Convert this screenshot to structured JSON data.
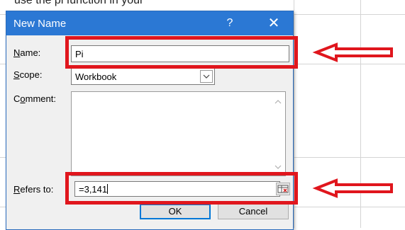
{
  "background": {
    "top_text": "use the pi function in your"
  },
  "dialog": {
    "title": "New Name",
    "help_label": "?",
    "close_label": "✕",
    "name_label_prefix": "",
    "name_label_hot": "N",
    "name_label_rest": "ame:",
    "name_value": "Pi",
    "scope_label_hot": "S",
    "scope_label_rest": "cope:",
    "scope_value": "Workbook",
    "comment_label_pre": "C",
    "comment_label_hot": "o",
    "comment_label_rest": "mment:",
    "comment_value": "",
    "refers_label_hot": "R",
    "refers_label_rest": "efers to:",
    "refers_value": "=3,141",
    "ok_label": "OK",
    "cancel_label": "Cancel"
  },
  "annotations": {
    "highlight_color": "#e0161d",
    "title_bar_color": "#2b78d4"
  }
}
